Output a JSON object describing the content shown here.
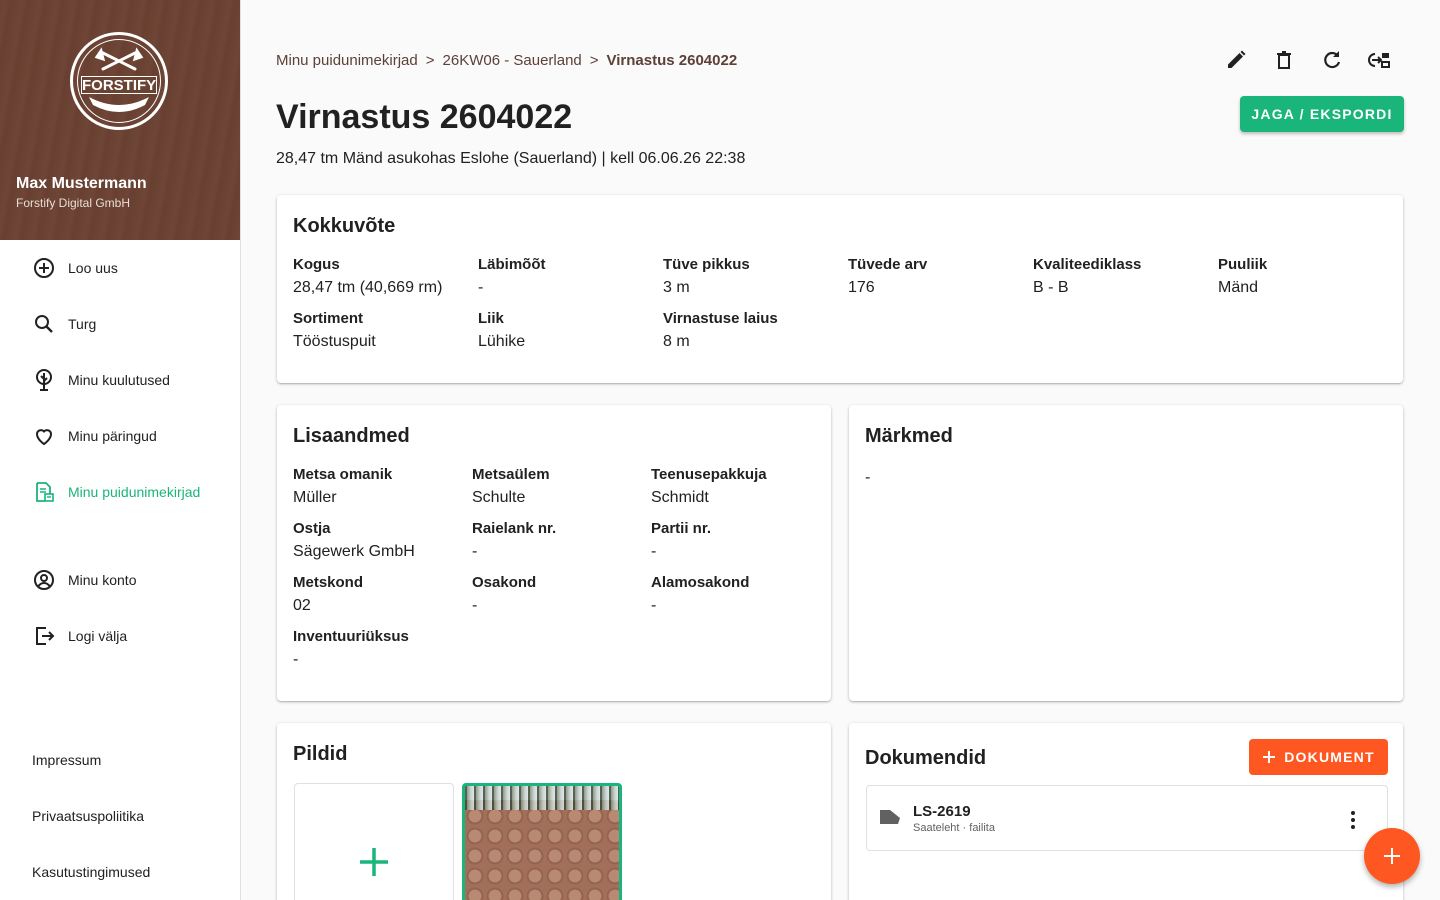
{
  "sidebar": {
    "brand": "FORSTIFY",
    "user_name": "Max Mustermann",
    "user_company": "Forstify Digital GmbH",
    "items": [
      {
        "label": "Loo uus",
        "icon": "plus-circle-icon"
      },
      {
        "label": "Turg",
        "icon": "search-icon"
      },
      {
        "label": "Minu kuulutused",
        "icon": "tree-icon"
      },
      {
        "label": "Minu päringud",
        "icon": "heart-icon"
      },
      {
        "label": "Minu puidunimekirjad",
        "icon": "document-list-icon",
        "active": true
      },
      {
        "label": "Minu konto",
        "icon": "account-circle-icon"
      },
      {
        "label": "Logi välja",
        "icon": "logout-icon"
      }
    ],
    "footer_links": [
      "Impressum",
      "Privaatsuspoliitika",
      "Kasutustingimused"
    ]
  },
  "breadcrumb": {
    "items": [
      "Minu puidunimekirjad",
      "26KW06 - Sauerland",
      "Virnastus 2604022"
    ],
    "separator": ">"
  },
  "toolbar": {
    "icons": [
      "edit-icon",
      "delete-icon",
      "refresh-icon",
      "export-icon"
    ]
  },
  "header": {
    "title": "Virnastus 2604022",
    "subtitle": "28,47 tm Mänd asukohas Eslohe (Sauerland) | kell 06.06.26 22:38",
    "share_label": "JAGA / EKSPORDI"
  },
  "summary": {
    "title": "Kokkuvõte",
    "fields": [
      {
        "label": "Kogus",
        "value": "28,47 tm (40,669 rm)"
      },
      {
        "label": "Läbimõõt",
        "value": "-"
      },
      {
        "label": "Tüve pikkus",
        "value": "3 m"
      },
      {
        "label": "Tüvede arv",
        "value": "176"
      },
      {
        "label": "Kvaliteediklass",
        "value": "B - B"
      },
      {
        "label": "Puuliik",
        "value": "Mänd"
      },
      {
        "label": "Sortiment",
        "value": "Tööstuspuit"
      },
      {
        "label": "Liik",
        "value": "Lühike"
      },
      {
        "label": "Virnastuse laius",
        "value": "8 m"
      }
    ]
  },
  "extra": {
    "title": "Lisaandmed",
    "fields": [
      {
        "label": "Metsa omanik",
        "value": "Müller"
      },
      {
        "label": "Metsaülem",
        "value": "Schulte"
      },
      {
        "label": "Teenusepakkuja",
        "value": "Schmidt"
      },
      {
        "label": "Ostja",
        "value": "Sägewerk GmbH"
      },
      {
        "label": "Raielank nr.",
        "value": "-"
      },
      {
        "label": "Partii nr.",
        "value": "-"
      },
      {
        "label": "Metskond",
        "value": "02"
      },
      {
        "label": "Osakond",
        "value": "-"
      },
      {
        "label": "Alamosakond",
        "value": "-"
      },
      {
        "label": "Inventuuriüksus",
        "value": "-"
      }
    ]
  },
  "notes": {
    "title": "Märkmed",
    "text": "-"
  },
  "images": {
    "title": "Pildid"
  },
  "documents": {
    "title": "Dokumendid",
    "add_label": "DOKUMENT",
    "items": [
      {
        "name": "LS-2619",
        "meta": "Saateleht · failita"
      }
    ]
  },
  "colors": {
    "accent": "#1ab57a",
    "secondary": "#ff5722",
    "brand_brown": "#6b4333"
  }
}
